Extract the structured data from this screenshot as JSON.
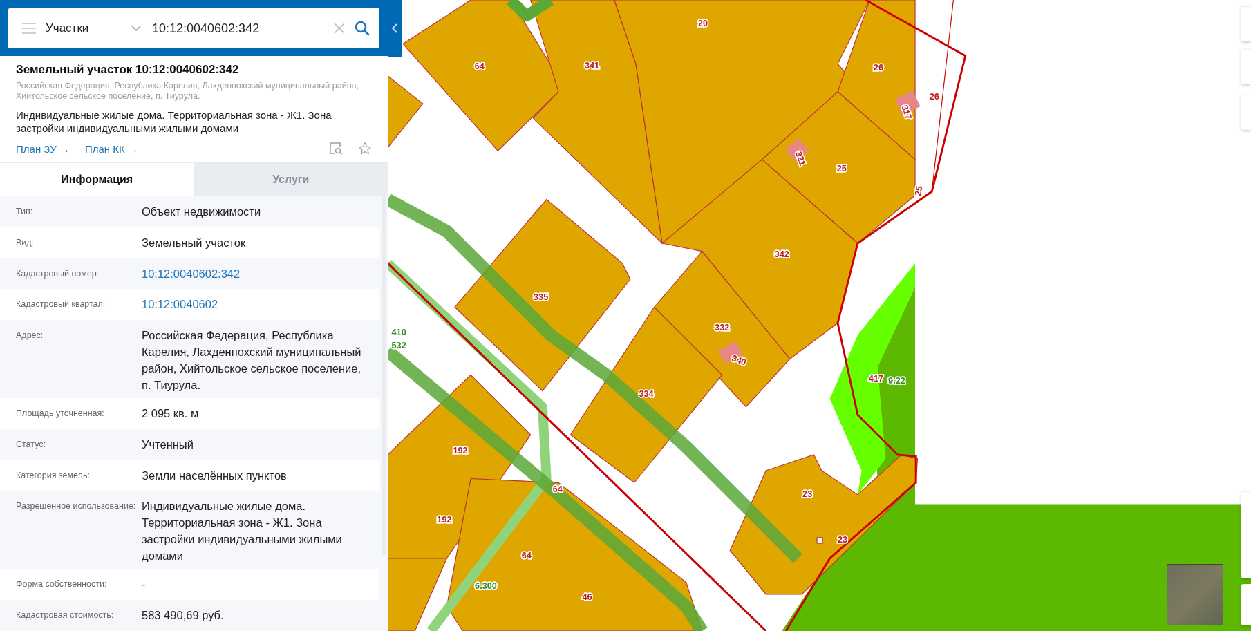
{
  "search": {
    "category": "Участки",
    "value": "10:12:0040602:342"
  },
  "card": {
    "title": "Земельный участок 10:12:0040602:342",
    "address": "Российская Федерация, Республика Карелия, Лахденпохский муниципальный район, Хийтольское сельское поселение, п. Тиурула.",
    "description": "Индивидуальные жилые дома. Территориальная зона - Ж1. Зона застройки индивидуальными жилыми домами",
    "links": [
      "План ЗУ →",
      "План КК →"
    ]
  },
  "tabs": [
    {
      "label": "Информация",
      "selected": true
    },
    {
      "label": "Услуги",
      "selected": false
    }
  ],
  "rows": [
    {
      "label": "Тип:",
      "value": "Объект недвижимости",
      "kind": "text"
    },
    {
      "label": "Вид:",
      "value": "Земельный участок",
      "kind": "text"
    },
    {
      "label": "Кадастровый номер:",
      "value": "10:12:0040602:342",
      "kind": "link"
    },
    {
      "label": "Кадастровый квартал:",
      "value": "10:12:0040602",
      "kind": "link"
    },
    {
      "label": "Адрес:",
      "value": "Российская Федерация, Республика Карелия, Лахденпохский муниципальный район, Хийтольское сельское поселение, п. Тиурула.",
      "kind": "text"
    },
    {
      "label": "Площадь уточненная:",
      "value": "2 095 кв. м",
      "kind": "text"
    },
    {
      "label": "Статус:",
      "value": "Учтенный",
      "kind": "text"
    },
    {
      "label": "Категория земель:",
      "value": "Земли населённых пунктов",
      "kind": "text"
    },
    {
      "label": "Разрешенное использование:",
      "value": "Индивидуальные жилые дома. Территориальная зона - Ж1. Зона застройки индивидуальными жилыми домами",
      "kind": "text"
    },
    {
      "label": "Форма собственности:",
      "value": "-",
      "kind": "text"
    },
    {
      "label": "Кадастровая стоимость:",
      "value": "583 490,69 руб.",
      "kind": "text"
    }
  ],
  "map": {
    "labels": [
      {
        "text": "64",
        "color": "#b22222"
      },
      {
        "text": "341",
        "color": "#b22222"
      },
      {
        "text": "20",
        "color": "#b22222"
      },
      {
        "text": "26",
        "color": "#b22222"
      },
      {
        "text": "26",
        "color": "#b22222"
      },
      {
        "text": "317",
        "color": "#b22222"
      },
      {
        "text": "321",
        "color": "#b22222"
      },
      {
        "text": "25",
        "color": "#b22222"
      },
      {
        "text": "25",
        "color": "#b22222"
      },
      {
        "text": "342",
        "color": "#b22222"
      },
      {
        "text": "335",
        "color": "#b22222"
      },
      {
        "text": "332",
        "color": "#b22222"
      },
      {
        "text": "340",
        "color": "#b22222"
      },
      {
        "text": "334",
        "color": "#b22222"
      },
      {
        "text": "417",
        "color": "#b22222"
      },
      {
        "text": "9.22",
        "color": "#3a8a2a"
      },
      {
        "text": "410",
        "color": "#3a8a2a"
      },
      {
        "text": "532",
        "color": "#3a8a2a"
      },
      {
        "text": "192",
        "color": "#b22222"
      },
      {
        "text": "192",
        "color": "#b22222"
      },
      {
        "text": "64",
        "color": "#b22222"
      },
      {
        "text": "64",
        "color": "#b22222"
      },
      {
        "text": "46",
        "color": "#b22222"
      },
      {
        "text": "23",
        "color": "#b22222"
      },
      {
        "text": "23",
        "color": "#b22222"
      },
      {
        "text": "6.300",
        "color": "#3a8a2a"
      }
    ]
  }
}
